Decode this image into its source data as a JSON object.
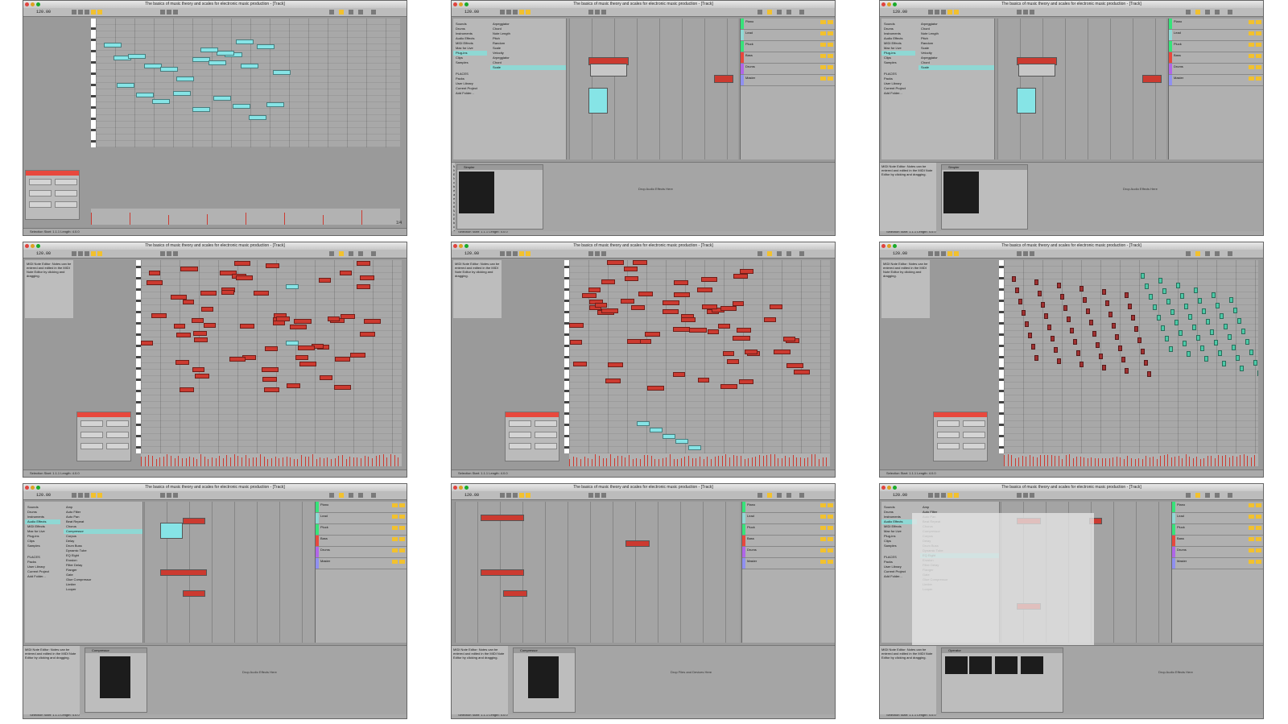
{
  "window_title": "The basics of music theory and scales for electronic music production - [Track]",
  "bpm": "120.00",
  "browser_labels": [
    "Sounds",
    "Drums",
    "Instruments",
    "Audio Effects",
    "MIDI Effects",
    "Max for Live",
    "Plug-ins",
    "Clips",
    "Samples"
  ],
  "places_labels": [
    "PLACES",
    "Packs",
    "User Library",
    "Current Project",
    "Add Folder..."
  ],
  "browser_items_a": [
    "Arpeggiator",
    "Chord",
    "Note Length",
    "Pitch",
    "Random",
    "Scale",
    "Velocity",
    "Arpeggiator",
    "Chord",
    "Scale"
  ],
  "browser_items_b": [
    "Amp",
    "Auto Filter",
    "Auto Pan",
    "Beat Repeat",
    "Chorus",
    "Compressor",
    "Corpus",
    "Delay",
    "Drum Buss",
    "Dynamic Tube",
    "EQ Eight",
    "Erosion",
    "Filter Delay",
    "Flanger",
    "Gate",
    "Glue Compressor",
    "Limiter",
    "Looper"
  ],
  "track_names": [
    "Piano",
    "Lead",
    "Pluck",
    "Bass",
    "Drums",
    "Master"
  ],
  "device_title": "Simpler",
  "device_title_2": "Compressor",
  "device_title_3": "Operator",
  "drop_text": "Drop Audio Effects Here",
  "drop_text_2": "Drop Files and Devices Here",
  "info_text": "MIDI Note Editor: Notes can be entered and edited in the MIDI Note Editor by clicking and dragging.",
  "status_text": "Selection Start: 1.1.1  Length: 4.0.0",
  "page_indicator": "1/4",
  "colors": {
    "note_cyan": "#86e4e6",
    "note_red": "#cc3a30",
    "note_dark_red": "#a03030",
    "note_teal": "#4cc9a7",
    "accent_orange": "#f08a2c",
    "accent_yellow": "#f2c12e"
  }
}
